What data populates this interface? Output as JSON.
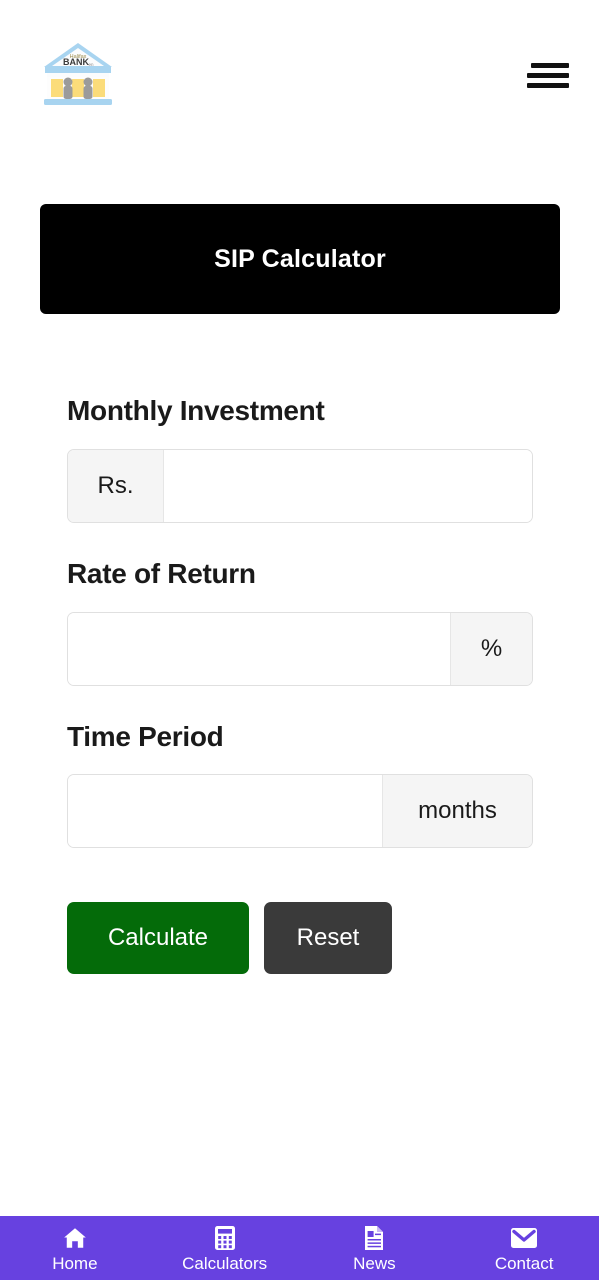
{
  "header": {
    "logo_icon": "bank-building-icon",
    "logo_text": "BANK",
    "menu_icon": "hamburger-menu-icon"
  },
  "banner": {
    "title": "SIP Calculator"
  },
  "form": {
    "fields": [
      {
        "label": "Monthly Investment",
        "prefix": "Rs.",
        "suffix": "",
        "value": "",
        "placeholder": ""
      },
      {
        "label": "Rate of Return",
        "prefix": "",
        "suffix": "%",
        "value": "",
        "placeholder": ""
      },
      {
        "label": "Time Period",
        "prefix": "",
        "suffix": "months",
        "value": "",
        "placeholder": ""
      }
    ],
    "buttons": {
      "calculate": "Calculate",
      "reset": "Reset"
    }
  },
  "bottom_nav": {
    "items": [
      {
        "label": "Home",
        "icon": "home-icon"
      },
      {
        "label": "Calculators",
        "icon": "calculator-icon"
      },
      {
        "label": "News",
        "icon": "news-document-icon"
      },
      {
        "label": "Contact",
        "icon": "envelope-icon"
      }
    ]
  },
  "colors": {
    "banner_background": "#000000",
    "calculate_button": "#046b09",
    "reset_button": "#3a3a3a",
    "nav_background": "#6741e0",
    "addon_background": "#f5f5f5",
    "page_background": "#ffffff"
  }
}
